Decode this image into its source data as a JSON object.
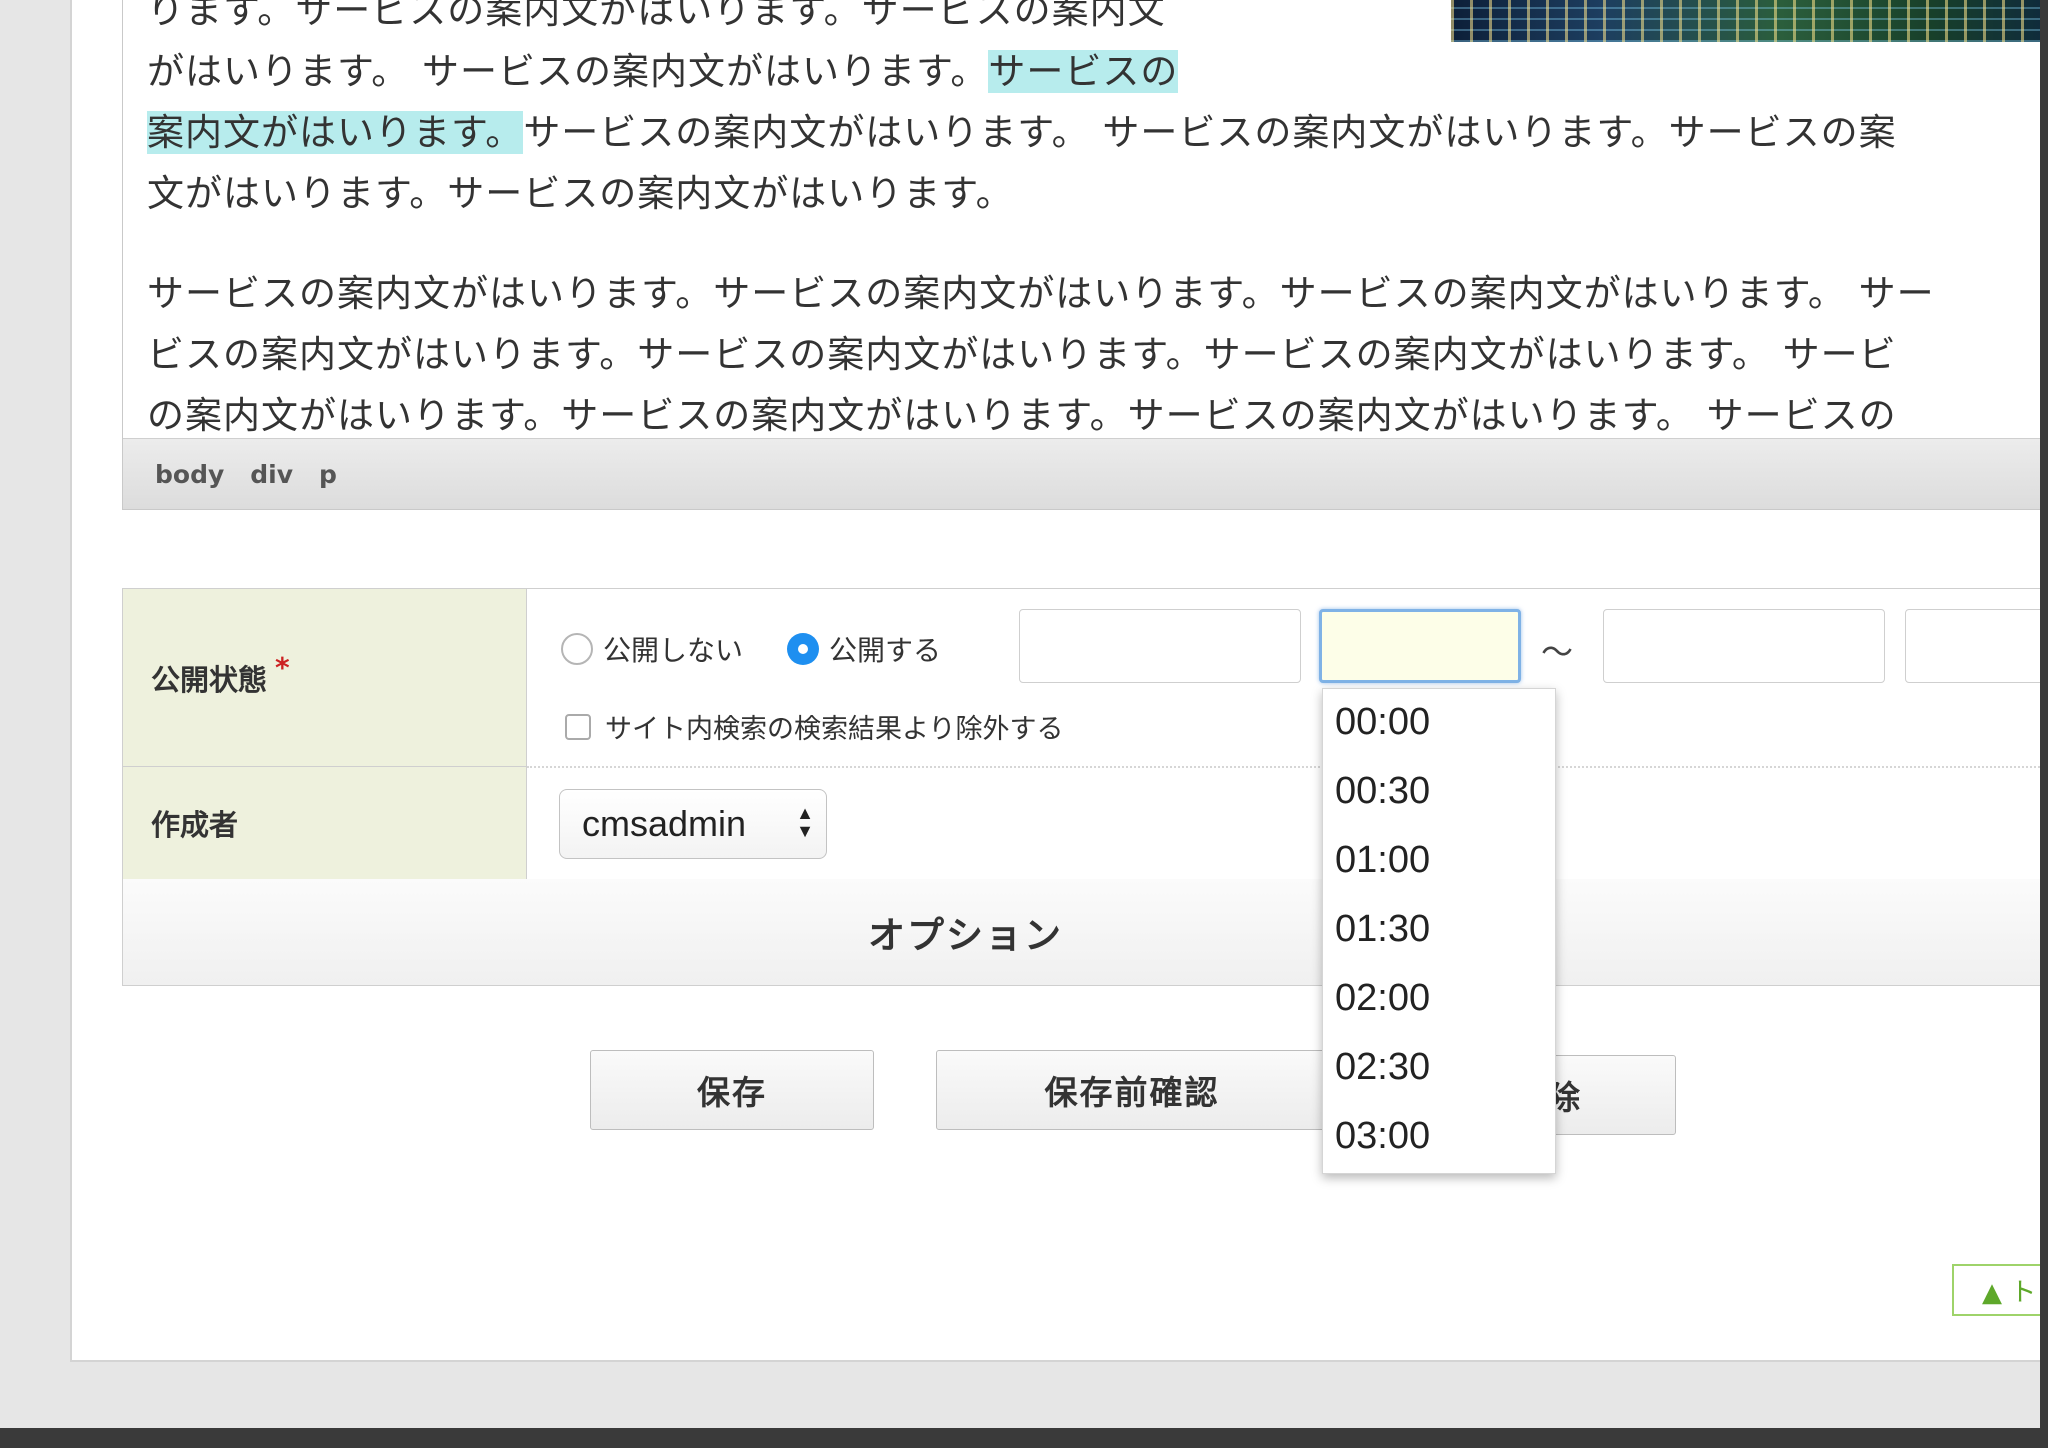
{
  "editor": {
    "lines": [
      "ります。サービスの案内文がはいります。サービスの案内文",
      "がはいります。 サービスの案内文がはいります。",
      "サービスの",
      "案内文がはいります。",
      "サービスの案内文がはいります。 サービスの案内文がはいります。サービスの案",
      "文がはいります。サービスの案内文がはいります。",
      "サービスの案内文がはいります。サービスの案内文がはいります。サービスの案内文がはいります。 サー",
      "ビスの案内文がはいります。サービスの案内文がはいります。サービスの案内文がはいります。 サービ",
      "の案内文がはいります。サービスの案内文がはいります。サービスの案内文がはいります。 サービスの"
    ],
    "status_path": [
      "body",
      "div",
      "p"
    ]
  },
  "form": {
    "publish_label": "公開状態",
    "required_mark": "*",
    "radio_off": "公開しない",
    "radio_on": "公開する",
    "exclude_search": "サイト内検索の検索結果より除外する",
    "tilde": "～",
    "author_label": "作成者",
    "author_value": "cmsadmin",
    "options_label": "オプション"
  },
  "buttons": {
    "save": "保存",
    "preview": "保存前確認",
    "delete_partial": "除"
  },
  "dropdown": {
    "times": [
      "00:00",
      "00:30",
      "01:00",
      "01:30",
      "02:00",
      "02:30",
      "03:00"
    ]
  },
  "to_top": "▲ ト"
}
